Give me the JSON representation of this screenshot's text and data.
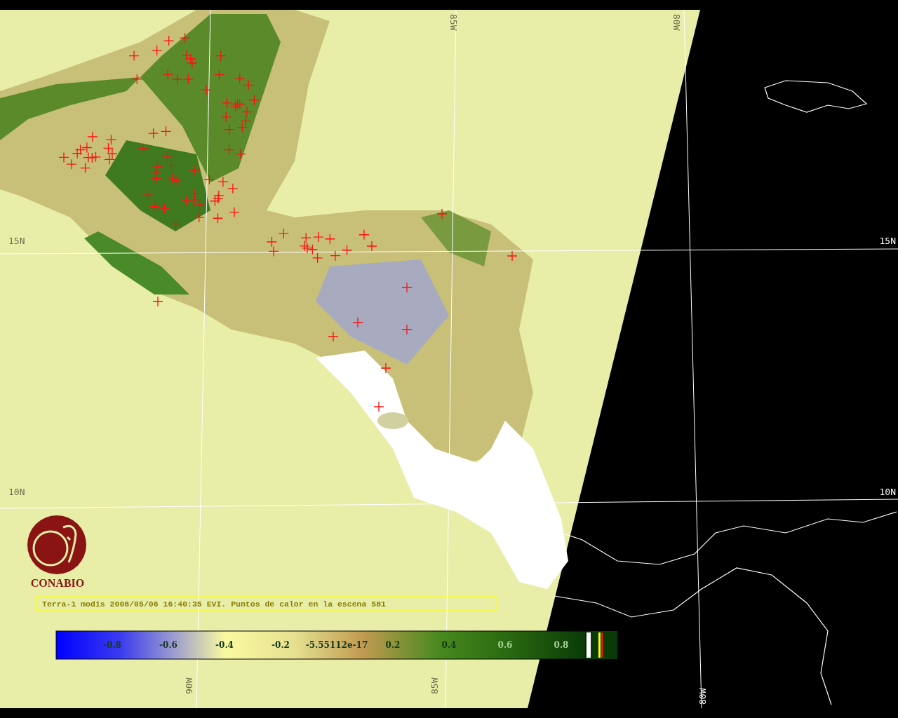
{
  "map": {
    "grid_labels": [
      {
        "text": "15N",
        "kind": "lat"
      },
      {
        "text": "15N",
        "kind": "lat"
      },
      {
        "text": "10N",
        "kind": "lat"
      },
      {
        "text": "10N",
        "kind": "lat"
      },
      {
        "text": "85W",
        "kind": "lon"
      },
      {
        "text": "80W",
        "kind": "lon"
      },
      {
        "text": "90W",
        "kind": "lon"
      },
      {
        "text": "85W",
        "kind": "lon"
      },
      {
        "text": "80W",
        "kind": "lon"
      }
    ],
    "caption": "Terra-1 modis 2008/05/06 16:40:35 EVI. Puntos de calor en la escena 581"
  },
  "logo": {
    "text": "CONABIO"
  },
  "legend": {
    "ticks": [
      "-0.8",
      "-0.6",
      "-0.4",
      "-0.2",
      "-5.55112e-17",
      "0.2",
      "0.4",
      "0.6",
      "0.8"
    ]
  }
}
